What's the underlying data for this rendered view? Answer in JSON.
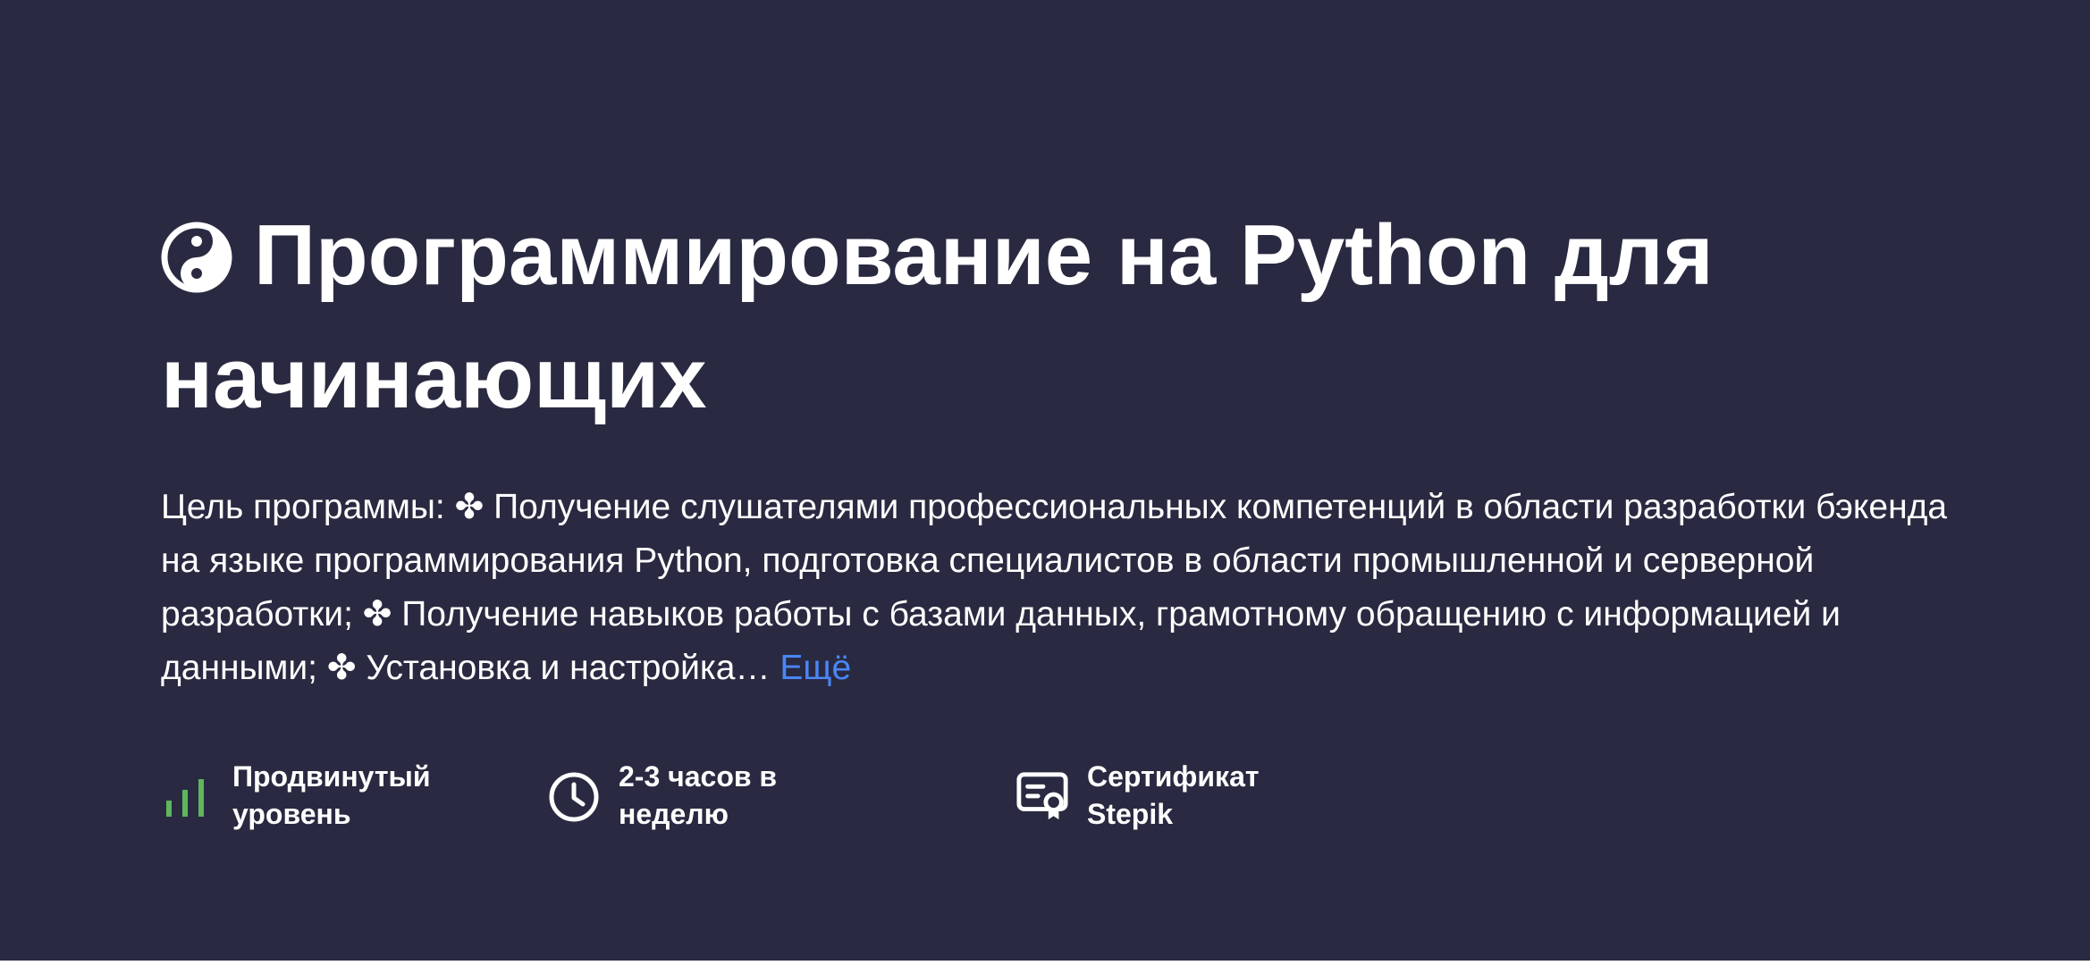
{
  "course": {
    "title": "Программирование на Python для начинающих",
    "title_icon": "yin-yang-icon",
    "description": "Цель программы: ✤ Получение слушателями профессиональных компетенций в области разработки бэкенда на языке программирования Python, подготовка специалистов в области промышленной и серверной разработки; ✤ Получение навыков работы с базами данных, грамотному обращению с информацией и данными; ✤ Установка и настройка…",
    "more_label": "Ещё"
  },
  "features": {
    "level": {
      "icon": "signal-bars-icon",
      "line1": "Продвинутый",
      "line2": "уровень"
    },
    "time": {
      "icon": "clock-icon",
      "line1": "2-3 часов в",
      "line2": "неделю"
    },
    "certificate": {
      "icon": "certificate-icon",
      "line1": "Сертификат",
      "line2": "Stepik"
    }
  },
  "colors": {
    "background": "#292a41",
    "text": "#ffffff",
    "link": "#4a86f7",
    "level_bars": "#5fb65c"
  }
}
